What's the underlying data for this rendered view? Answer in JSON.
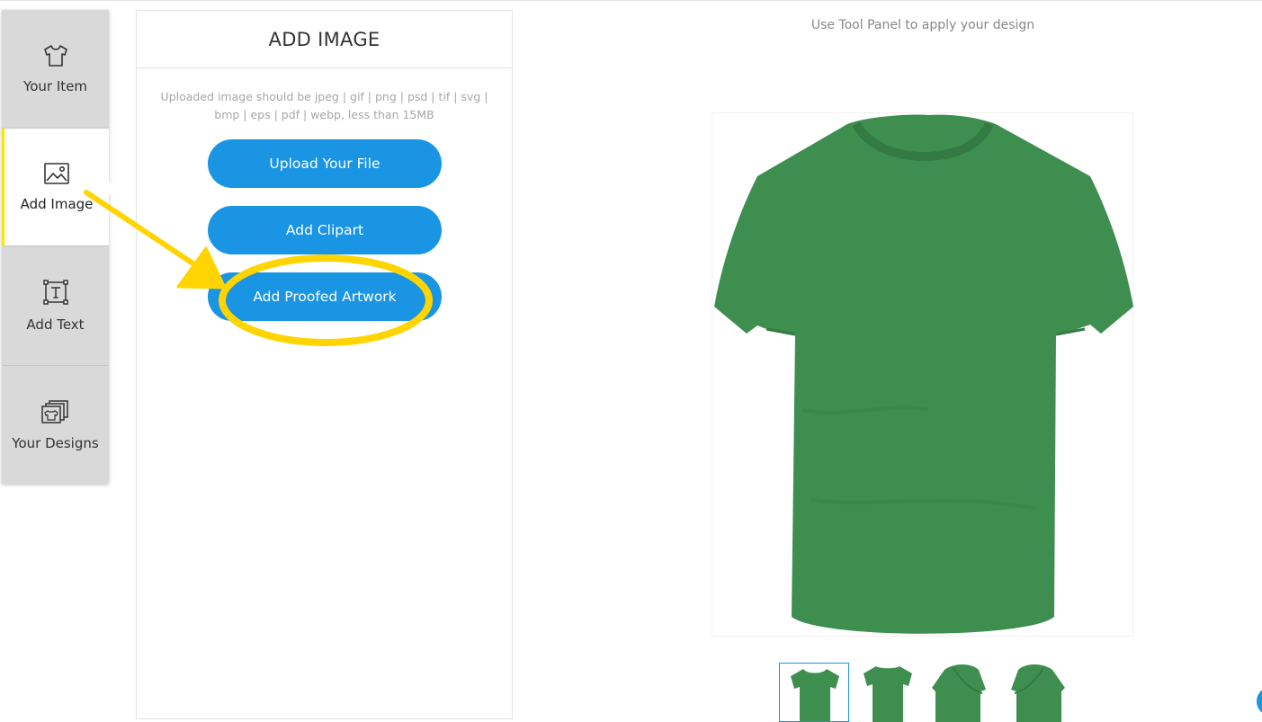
{
  "sidebar": {
    "items": [
      {
        "label": "Your Item",
        "icon": "tshirt-icon"
      },
      {
        "label": "Add Image",
        "icon": "image-icon"
      },
      {
        "label": "Add Text",
        "icon": "text-box-icon"
      },
      {
        "label": "Your Designs",
        "icon": "designs-stack-icon"
      }
    ],
    "active_index": 1
  },
  "panel": {
    "title": "ADD IMAGE",
    "note": "Uploaded image should be jpeg | gif | png | psd | tif | svg | bmp | eps | pdf | webp, less than 15MB",
    "buttons": {
      "upload": "Upload Your File",
      "clipart": "Add Clipart",
      "proofed": "Add Proofed Artwork"
    }
  },
  "canvas": {
    "hint": "Use Tool Panel to apply your design",
    "product_color": "#3e8e4f",
    "thumbnails": [
      "front",
      "back",
      "left-side",
      "right-side"
    ]
  },
  "colors": {
    "accent_blue": "#1a95e3",
    "annotation_yellow": "#ffd400",
    "active_marker": "#ffe600"
  }
}
